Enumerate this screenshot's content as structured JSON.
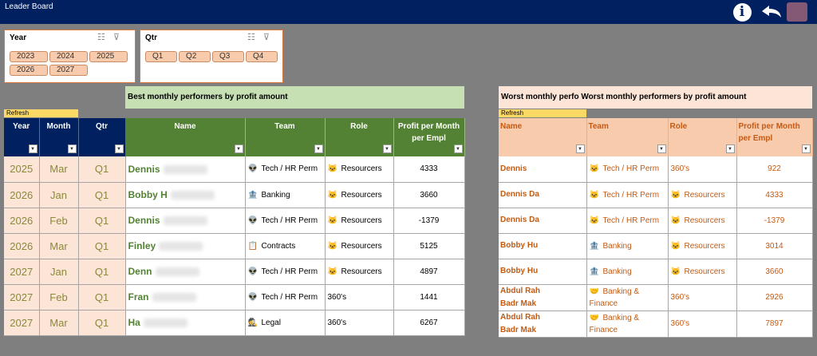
{
  "app": {
    "title": "Leader Board"
  },
  "slicers": {
    "year": {
      "title": "Year",
      "options": [
        "2023",
        "2024",
        "2025",
        "2026",
        "2027"
      ]
    },
    "qtr": {
      "title": "Qtr",
      "options": [
        "Q1",
        "Q2",
        "Q3",
        "Q4"
      ]
    }
  },
  "best": {
    "banner": "Best monthly  performers by profit amount",
    "refresh": "Refresh",
    "headers": [
      "Year",
      "Month",
      "Qtr",
      "Name",
      "Team",
      "Role",
      "Profit per Month per Empl"
    ],
    "rows": [
      {
        "year": "2025",
        "month": "Mar",
        "qtr": "Q1",
        "name": "Dennis",
        "team": "Tech / HR Perm",
        "team_icon": "alien-icon",
        "role": "Resourcers",
        "role_icon": "cat-icon",
        "profit": "4333"
      },
      {
        "year": "2026",
        "month": "Jan",
        "qtr": "Q1",
        "name": "Bobby H",
        "team": "Banking",
        "team_icon": "bank-icon",
        "role": "Resourcers",
        "role_icon": "cat-icon",
        "profit": "3660"
      },
      {
        "year": "2026",
        "month": "Feb",
        "qtr": "Q1",
        "name": "Dennis",
        "team": "Tech / HR Perm",
        "team_icon": "alien-icon",
        "role": "Resourcers",
        "role_icon": "cat-icon",
        "profit": "-1379"
      },
      {
        "year": "2026",
        "month": "Mar",
        "qtr": "Q1",
        "name": "Finley",
        "team": "Contracts",
        "team_icon": "contract-icon",
        "role": "Resourcers",
        "role_icon": "cat-icon",
        "profit": "5125"
      },
      {
        "year": "2027",
        "month": "Jan",
        "qtr": "Q1",
        "name": "Denn",
        "team": "Tech / HR Perm",
        "team_icon": "alien-icon",
        "role": "Resourcers",
        "role_icon": "cat-icon",
        "profit": "4897"
      },
      {
        "year": "2027",
        "month": "Feb",
        "qtr": "Q1",
        "name": "Fran",
        "team": "Tech / HR Perm",
        "team_icon": "alien-icon",
        "role": "360's",
        "role_icon": "",
        "profit": "1441"
      },
      {
        "year": "2027",
        "month": "Mar",
        "qtr": "Q1",
        "name": "Ha",
        "team": "Legal",
        "team_icon": "detective-icon",
        "role": "360's",
        "role_icon": "",
        "profit": "6267"
      }
    ]
  },
  "worst": {
    "banner": "Worst monthly  perfo Worst monthly  performers by profit amount",
    "refresh": "Refresh",
    "headers": [
      "Name",
      "Team",
      "Role",
      "Profit per Month per Empl"
    ],
    "rows": [
      {
        "name": "Dennis",
        "team": "Tech / HR Perm",
        "team_icon": "cat-icon",
        "role": "360's",
        "role_icon": "",
        "profit": "922"
      },
      {
        "name": "Dennis Da",
        "team": "Tech / HR Perm",
        "team_icon": "cat-icon",
        "role": "Resourcers",
        "role_icon": "cat-icon",
        "profit": "4333"
      },
      {
        "name": "Dennis Da",
        "team": "Tech / HR Perm",
        "team_icon": "cat-icon",
        "role": "Resourcers",
        "role_icon": "cat-icon",
        "profit": "-1379"
      },
      {
        "name": "Bobby Hu",
        "team": "Banking",
        "team_icon": "bank-icon",
        "role": "Resourcers",
        "role_icon": "cat-icon",
        "profit": "3014"
      },
      {
        "name": "Bobby Hu",
        "team": "Banking",
        "team_icon": "bank-icon",
        "role": "Resourcers",
        "role_icon": "cat-icon",
        "profit": "3660"
      },
      {
        "name": "Abdul Rah\nBadr Mak",
        "team": "Banking & Finance",
        "team_icon": "hand-icon",
        "role": "360's",
        "role_icon": "",
        "profit": "2926"
      },
      {
        "name": "Abdul Rah\nBadr Mak",
        "team": "Banking & Finance",
        "team_icon": "hand-icon",
        "role": "360's",
        "role_icon": "",
        "profit": "7897"
      }
    ]
  },
  "colors": {
    "header_navy": "#002060",
    "header_green": "#548235",
    "peach": "#fce4d6",
    "orange_text": "#c55a11"
  }
}
